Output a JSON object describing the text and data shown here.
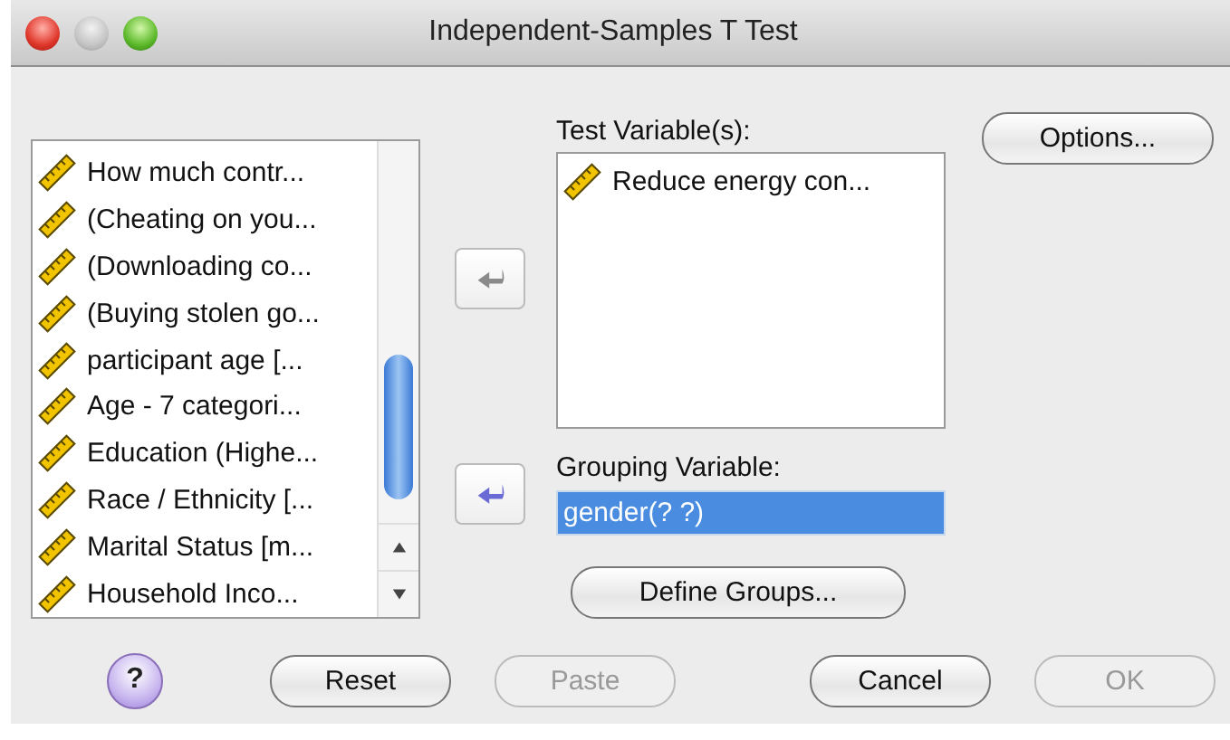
{
  "window": {
    "title": "Independent-Samples T Test"
  },
  "source_list": {
    "items": [
      {
        "label": "How much contr..."
      },
      {
        "label": "(Cheating on you..."
      },
      {
        "label": "(Downloading co..."
      },
      {
        "label": "(Buying stolen go..."
      },
      {
        "label": "participant age [..."
      },
      {
        "label": "Age - 7 categori..."
      },
      {
        "label": "Education (Highe..."
      },
      {
        "label": "Race / Ethnicity [..."
      },
      {
        "label": "Marital Status [m..."
      },
      {
        "label": "Household Inco..."
      }
    ]
  },
  "move_buttons": [
    {
      "disabled": true
    },
    {
      "disabled": false
    }
  ],
  "test_variables": {
    "label": "Test Variable(s):",
    "items": [
      {
        "label": "Reduce energy con..."
      }
    ]
  },
  "grouping_variable": {
    "label": "Grouping Variable:",
    "value": "gender(? ?)",
    "selected": true
  },
  "options_button": {
    "label": "Options...",
    "disabled": false
  },
  "define_groups_button": {
    "label": "Define Groups...",
    "disabled": false
  },
  "footer_buttons": [
    {
      "kind": "help",
      "label": "?",
      "disabled": false
    },
    {
      "kind": "push",
      "label": "Reset",
      "disabled": false
    },
    {
      "kind": "push",
      "label": "Paste",
      "disabled": true
    },
    {
      "kind": "push",
      "label": "Cancel",
      "disabled": false
    },
    {
      "kind": "push",
      "label": "OK",
      "disabled": true
    }
  ]
}
